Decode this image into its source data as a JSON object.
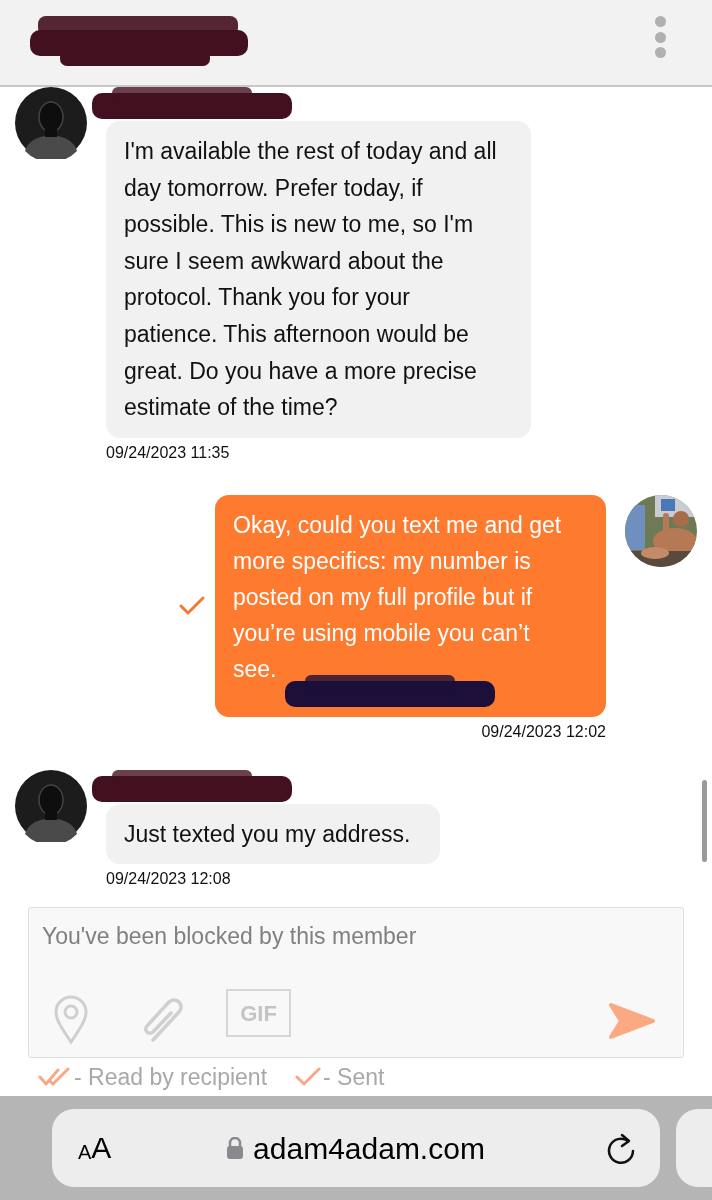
{
  "messages": [
    {
      "kind": "received",
      "text": "I'm available the rest of today and all day tomorrow. Prefer today, if possible. This is new to me, so I'm sure I seem awkward about the protocol. Thank you for your patience. This afternoon would be great. Do you have a more precise estimate of the time?",
      "time": "09/24/2023 11:35"
    },
    {
      "kind": "sent",
      "text": "Okay, could you text me and get more specifics: my number is posted on my full profile but if you’re using mobile you can’t see.",
      "time": "09/24/2023 12:02",
      "read": false
    },
    {
      "kind": "received",
      "text": "Just texted you my address.",
      "time": "09/24/2023 12:08"
    }
  ],
  "composer": {
    "placeholder": "You've been blocked by this member",
    "gif_label": "GIF"
  },
  "legend": [
    {
      "kind": "double_check",
      "label": "- Read by recipient"
    },
    {
      "kind": "single_check",
      "label": "- Sent"
    }
  ],
  "browser": {
    "text_size_label": "AA",
    "url": "adam4adam.com"
  }
}
